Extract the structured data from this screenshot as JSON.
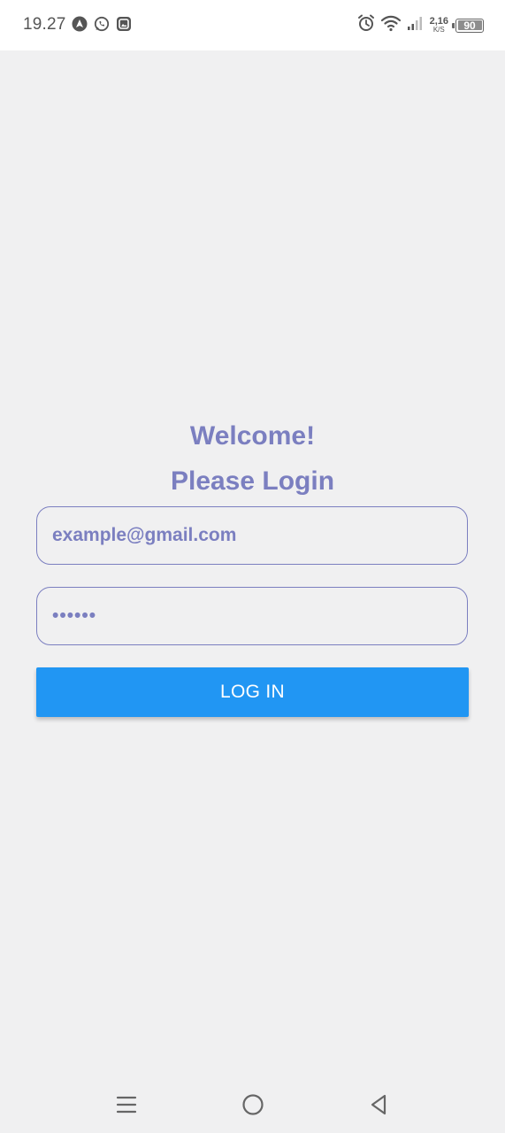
{
  "status_bar": {
    "time": "19.27",
    "left_icons": [
      "navigation-app-icon",
      "whatsapp-icon",
      "gallery-icon"
    ],
    "right_icons": [
      "alarm-icon",
      "wifi-icon",
      "signal-icon"
    ],
    "net_speed_value": "2,16",
    "net_speed_unit": "K/S",
    "battery_level": "90"
  },
  "login": {
    "title_line1": "Welcome!",
    "title_line2": "Please Login",
    "email_value": "example@gmail.com",
    "password_value": "••••••",
    "login_button_label": "LOG IN"
  },
  "nav_bar": {
    "icons": [
      "menu-icon",
      "home-icon",
      "back-icon"
    ]
  },
  "colors": {
    "accent": "#7b7fc0",
    "button": "#2196f3",
    "background": "#f0f0f1"
  }
}
